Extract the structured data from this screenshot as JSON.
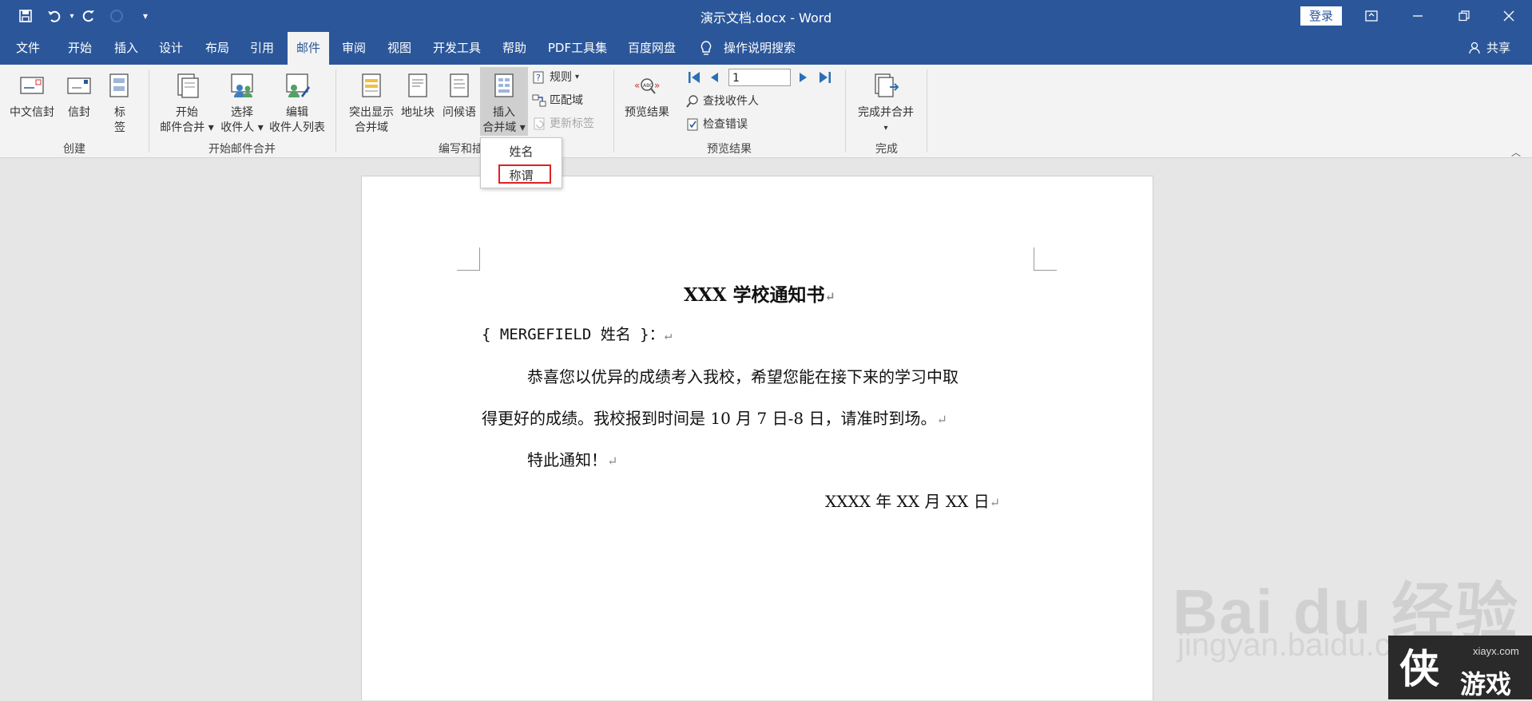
{
  "quick_access": {
    "save_icon": "save-icon",
    "undo_icon": "undo-icon",
    "redo_icon": "redo-icon",
    "customize_icon": "customize-icon"
  },
  "window": {
    "title": "演示文档.docx - Word",
    "login": "登录"
  },
  "tabs": [
    "文件",
    "开始",
    "插入",
    "设计",
    "布局",
    "引用",
    "邮件",
    "审阅",
    "视图",
    "开发工具",
    "帮助",
    "PDF工具集",
    "百度网盘"
  ],
  "active_tab": "邮件",
  "tell_me": "操作说明搜索",
  "share": "共享",
  "ribbon": {
    "create": {
      "label": "创建",
      "envelope_cn": "中文信封",
      "envelope": "信封",
      "labels_1": "标",
      "labels_2": "签"
    },
    "start_merge": {
      "label": "开始邮件合并",
      "start_1": "开始",
      "start_2": "邮件合并",
      "select_1": "选择",
      "select_2": "收件人",
      "edit_1": "编辑",
      "edit_2": "收件人列表"
    },
    "write_insert": {
      "label": "编写和插",
      "highlight_1": "突出显示",
      "highlight_2": "合并域",
      "address_block": "地址块",
      "greeting_line": "问候语",
      "insert_1": "插入",
      "insert_2": "合并域",
      "rules": "规则",
      "match_fields": "匹配域",
      "update_labels": "更新标签"
    },
    "preview": {
      "label": "预览结果",
      "preview_results": "预览结果",
      "record_value": "1",
      "find_recipient": "查找收件人",
      "check_errors": "检查错误"
    },
    "finish": {
      "label": "完成",
      "finish_merge": "完成并合并"
    }
  },
  "dropdown": {
    "items": [
      "姓名",
      "称谓"
    ]
  },
  "document": {
    "title": "XXX 学校通知书",
    "mergefield": "{ MERGEFIELD 姓名 }：",
    "para1_line1": "恭喜您以优异的成绩考入我校，希望您能在接下来的学习中取",
    "para1_line2": "得更好的成绩。我校报到时间是 10 月 7 日-8 日，请准时到场。",
    "para2": "特此通知！",
    "date": "XXXX 年 XX 月 XX 日",
    "return_mark": "↵"
  },
  "watermark": {
    "brand": "Bai du 经验",
    "url": "jingyan.baidu.com",
    "corner_site": "xiayx.com",
    "corner_text": "游戏"
  }
}
